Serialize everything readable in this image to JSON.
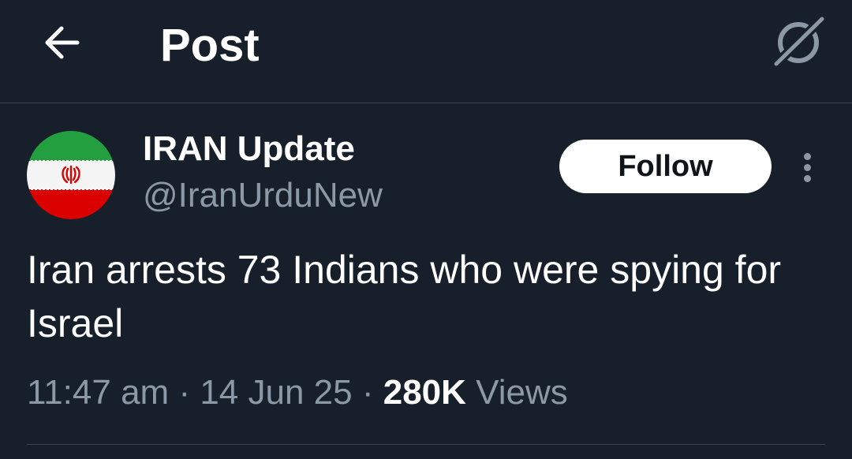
{
  "header": {
    "title": "Post",
    "back_icon": "arrow-left-icon",
    "grok_icon": "grok-icon"
  },
  "author": {
    "display_name": "IRAN Update",
    "handle": "@IranUrduNew",
    "avatar": "iran-flag-avatar"
  },
  "actions": {
    "follow_label": "Follow",
    "more_icon": "vertical-dots-icon"
  },
  "tweet": {
    "text": "Iran arrests 73 Indians who were spying for Israel",
    "time": "11:47 am",
    "date": "14 Jun 25",
    "separator": "·",
    "views_count": "280K",
    "views_label": "Views"
  },
  "colors": {
    "background": "#17202a",
    "text_primary": "#ffffff",
    "text_secondary": "#8b98a5",
    "divider": "#38444d",
    "flag_green": "#239f40",
    "flag_white": "#ffffff",
    "flag_red": "#da0000"
  }
}
